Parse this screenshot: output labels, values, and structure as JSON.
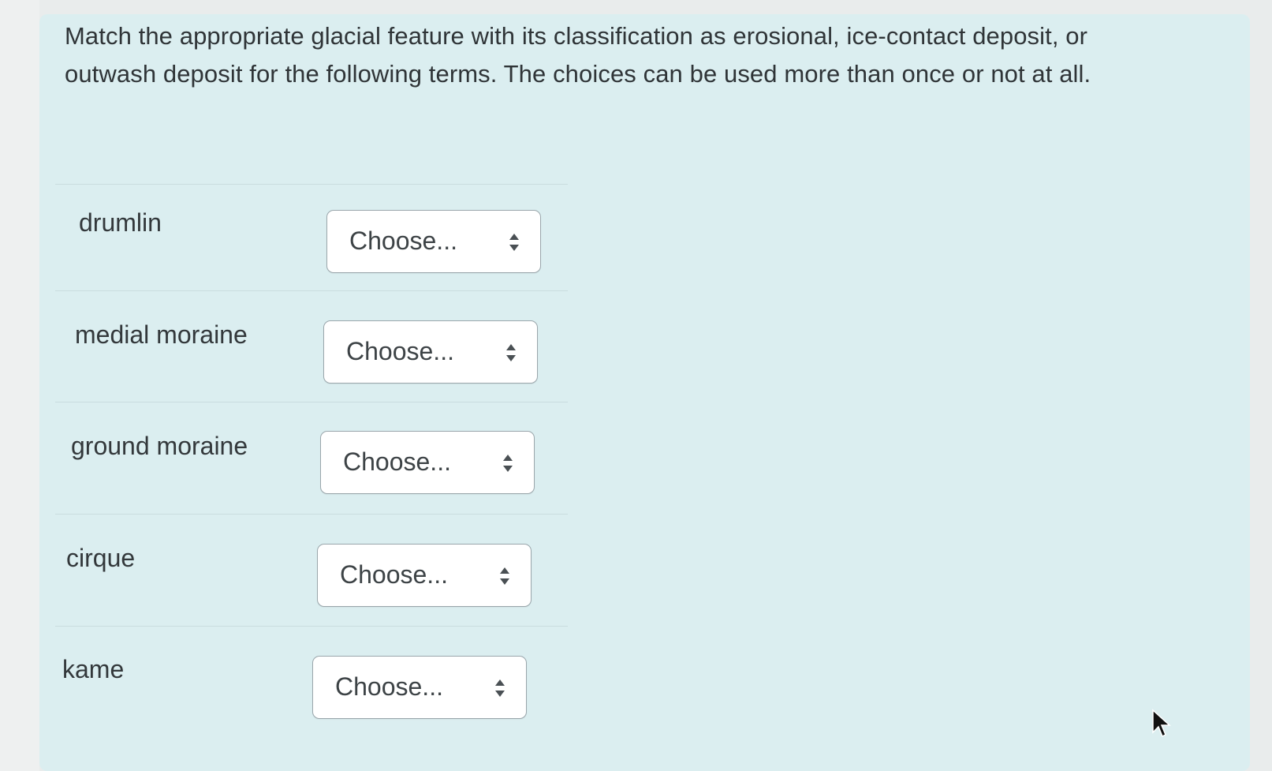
{
  "question": {
    "text": "Match the appropriate glacial feature with its classification as erosional, ice-contact deposit, or outwash deposit for the following terms. The choices can be used more than once or not at all."
  },
  "rows": [
    {
      "term": "drumlin",
      "select_value": "Choose..."
    },
    {
      "term": "medial moraine",
      "select_value": "Choose..."
    },
    {
      "term": "ground moraine",
      "select_value": "Choose..."
    },
    {
      "term": "cirque",
      "select_value": "Choose..."
    },
    {
      "term": "kame",
      "select_value": "Choose..."
    }
  ],
  "icons": {
    "select_arrow": "up-down-chevron-icon",
    "pointer": "mouse-pointer-icon"
  },
  "colors": {
    "panel_background": "#dbeef0",
    "text": "#2f3437",
    "select_border": "#9aa6ab"
  }
}
